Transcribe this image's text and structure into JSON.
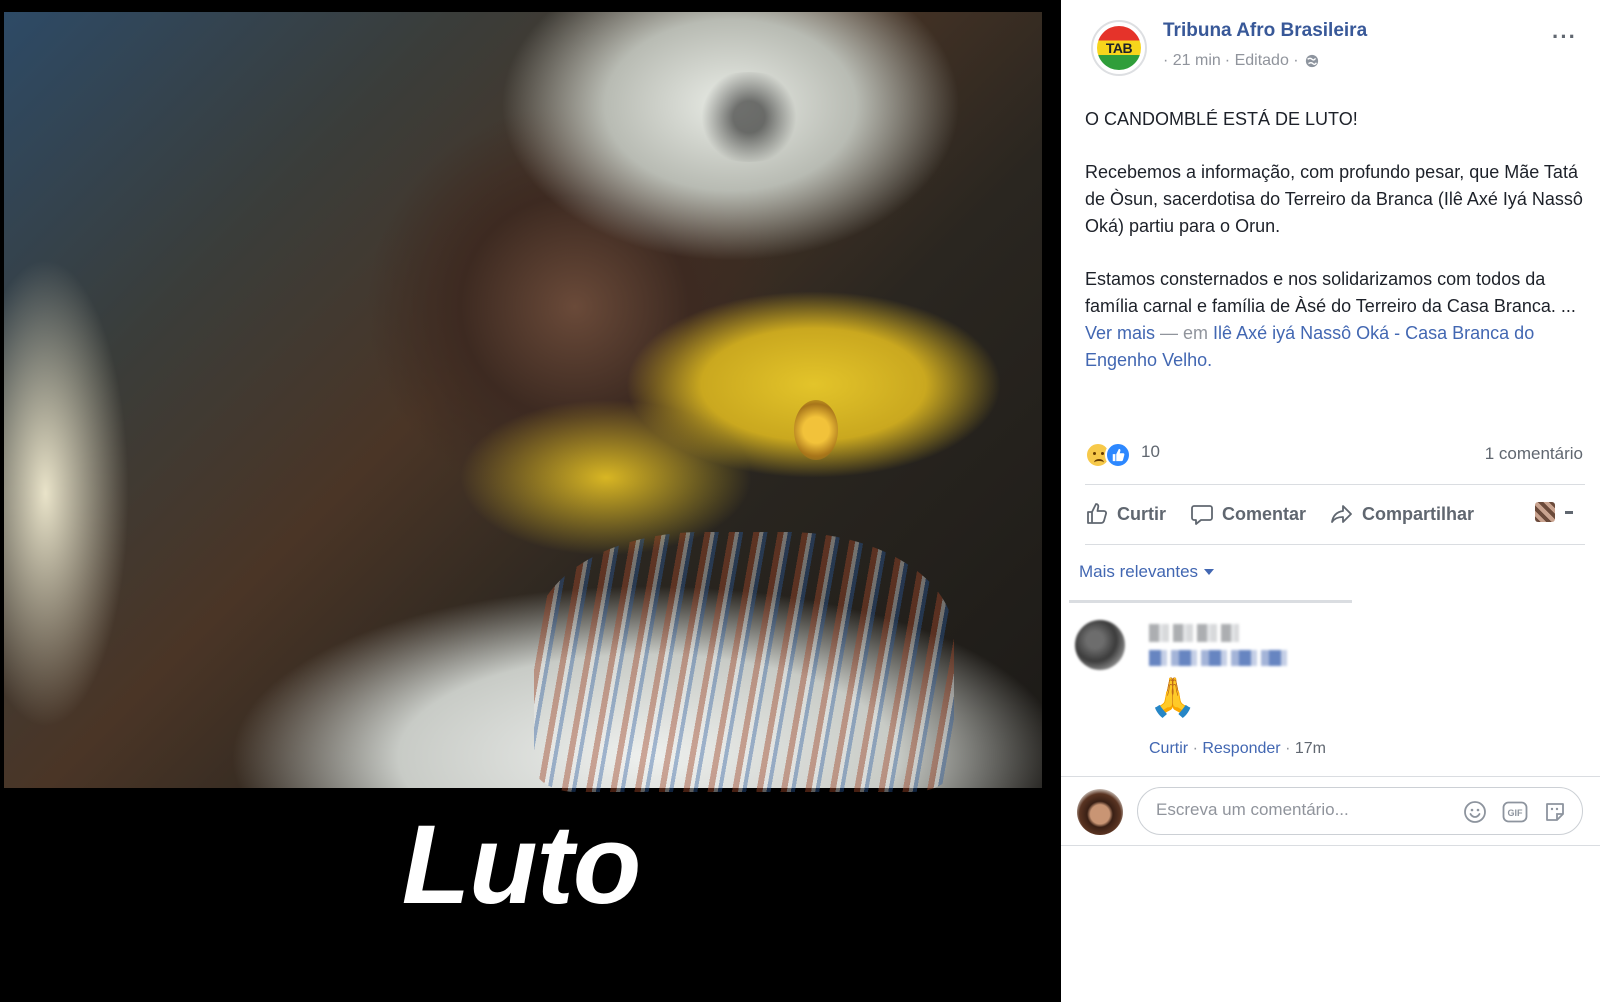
{
  "image_caption": "Luto",
  "post": {
    "page_name": "Tribuna Afro Brasileira",
    "logo_text": "TAB",
    "time": "· 21 min",
    "edited": "· Editado ·",
    "more": "···",
    "title_line": "O CANDOMBLÉ ESTÁ DE LUTO!",
    "paragraph1": "Recebemos a informação, com profundo pesar, que Mãe Tatá de Òsun, sacerdotisa do Terreiro da Branca (Ilê Axé Iyá Nassô Oká) partiu para o Orun.",
    "paragraph2_text": "Estamos consternados e nos solidarizamos com todos da família carnal e família de Àsé do Terreiro da Casa Branca. ...",
    "see_more": "Ver mais",
    "at_sep": " — em ",
    "location_link": "Ilê Axé iyá Nassô Oká - Casa Branca do Engenho Velho."
  },
  "reactions": {
    "count": "10",
    "comments": "1 comentário"
  },
  "actions": {
    "like": "Curtir",
    "comment": "Comentar",
    "share": "Compartilhar"
  },
  "comments_sort": "Mais relevantes",
  "comment": {
    "emoji": "🙏",
    "like": "Curtir",
    "reply": "Responder",
    "time": "17m"
  },
  "composer": {
    "placeholder": "Escreva um comentário..."
  },
  "colors": {
    "link": "#4267b2",
    "page_name": "#385898",
    "muted": "#90949c",
    "action": "#606770"
  }
}
